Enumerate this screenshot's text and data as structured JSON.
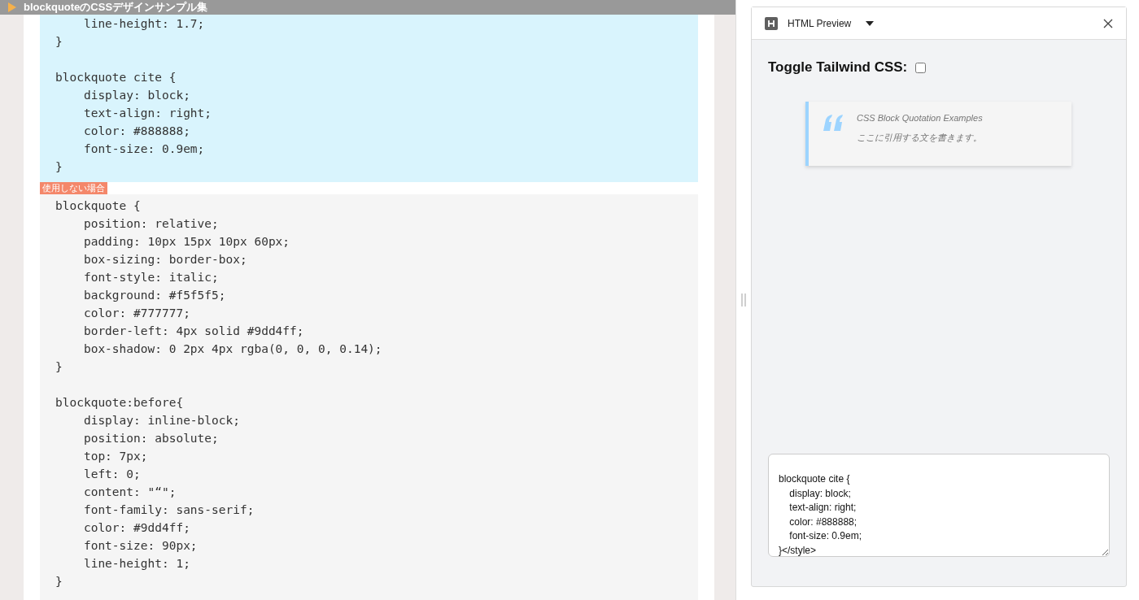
{
  "title_bar": {
    "title": "blockquoteのCSSデザインサンプル集"
  },
  "code_blocks": [
    {
      "kind": "used",
      "code": "    line-height: 1.7;\n}\n\nblockquote cite {\n    display: block;\n    text-align: right;\n    color: #888888;\n    font-size: 0.9em;\n}"
    },
    {
      "kind": "unused",
      "badge": "使用しない場合",
      "code": "blockquote {\n    position: relative;\n    padding: 10px 15px 10px 60px;\n    box-sizing: border-box;\n    font-style: italic;\n    background: #f5f5f5;\n    color: #777777;\n    border-left: 4px solid #9dd4ff;\n    box-shadow: 0 2px 4px rgba(0, 0, 0, 0.14);\n}\n\nblockquote:before{\n    display: inline-block;\n    position: absolute;\n    top: 7px;\n    left: 0;\n    content: \"“\";\n    font-family: sans-serif;\n    color: #9dd4ff;\n    font-size: 90px;\n    line-height: 1;\n}"
    }
  ],
  "preview": {
    "title": "HTML Preview",
    "toggle": {
      "label": "Toggle Tailwind CSS:",
      "checked": false
    },
    "quote": {
      "title": "CSS Block Quotation Examples",
      "text": "ここに引用する文を書きます。"
    },
    "source": "blockquote cite {\n    display: block;\n    text-align: right;\n    color: #888888;\n    font-size: 0.9em;\n}</style>"
  }
}
